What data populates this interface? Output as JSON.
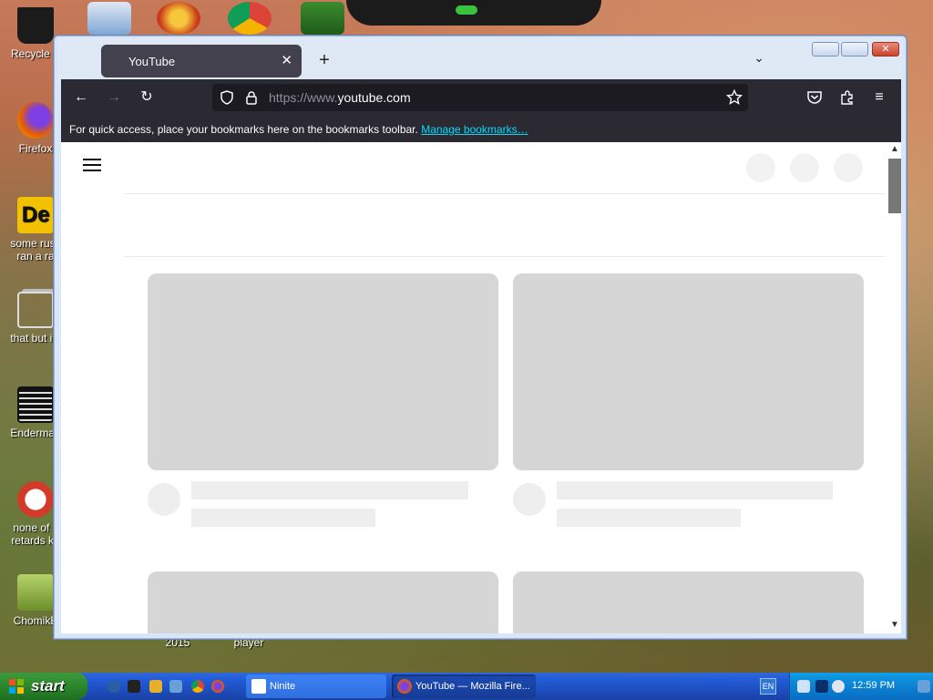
{
  "desktop": {
    "icons": [
      {
        "label": "Recycle B",
        "color": "#222222"
      },
      {
        "label": "Firefox",
        "color": "#e66000"
      },
      {
        "label": "some russ ran a ra",
        "color": "#f2c200"
      },
      {
        "label": "that but its",
        "color": "#bbbbbb"
      },
      {
        "label": "Enderman",
        "color": "#111111"
      },
      {
        "label": "none of y retards kn",
        "color": "#d23a2a"
      },
      {
        "label": "ChomikB",
        "color": "#7a9a3a"
      }
    ],
    "below_window_labels": [
      "2015",
      "player"
    ]
  },
  "browser": {
    "tab_title": "YouTube",
    "tab_close": "✕",
    "new_tab": "+",
    "list_all_tabs": "⌄",
    "url_scheme": "https://www.",
    "url_host": "youtube.com",
    "bookmarks_message": "For quick access, place your bookmarks here on the bookmarks toolbar.",
    "bookmarks_link": "Manage bookmarks…"
  },
  "taskbar": {
    "start_label": "start",
    "buttons": [
      {
        "label": "Ninite"
      },
      {
        "label": "YouTube — Mozilla Fire..."
      }
    ],
    "language": "EN",
    "clock": "12:59 PM"
  },
  "colors": {
    "browser_chrome": "#2b2a33",
    "urlbar": "#1c1b22",
    "link": "#00ddff",
    "skeleton": "#d6d6d6"
  }
}
